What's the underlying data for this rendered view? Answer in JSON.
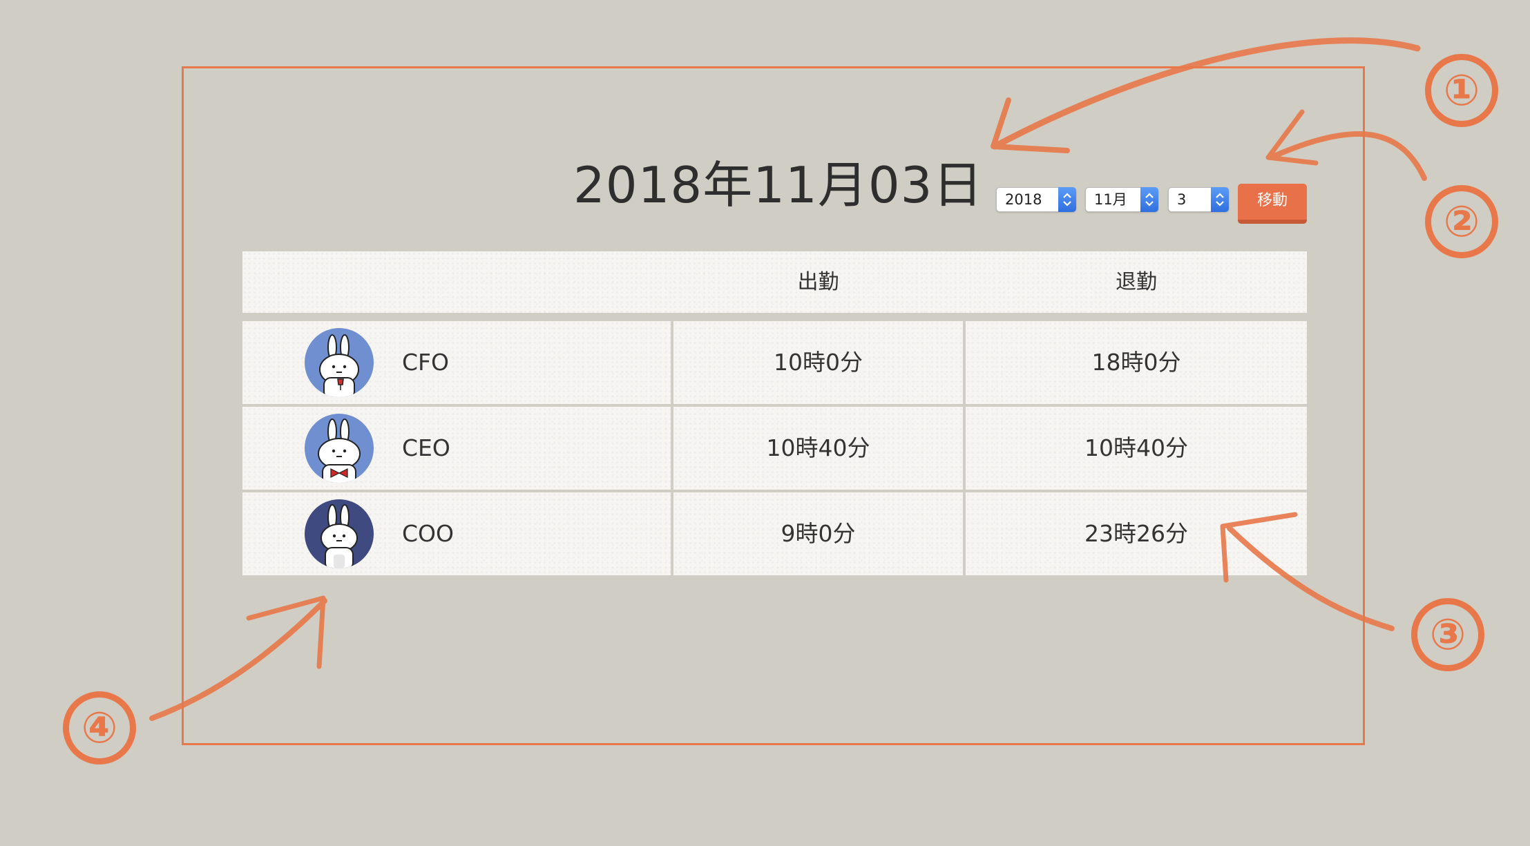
{
  "header": {
    "date_title": "2018年11月03日",
    "year_select": "2018",
    "month_select": "11月",
    "day_select": "3",
    "go_button": "移動"
  },
  "table": {
    "columns": [
      "",
      "出勤",
      "退勤"
    ],
    "rows": [
      {
        "role": "CFO",
        "clock_in": "10時0分",
        "clock_out": "18時0分",
        "avatar": "rabbit-with-wine-icon"
      },
      {
        "role": "CEO",
        "clock_in": "10時40分",
        "clock_out": "10時40分",
        "avatar": "rabbit-with-bowtie-icon"
      },
      {
        "role": "COO",
        "clock_in": "9時0分",
        "clock_out": "23時26分",
        "avatar": "rabbit-dark-icon"
      }
    ]
  },
  "annotations": {
    "labels": [
      "①",
      "②",
      "③",
      "④"
    ],
    "color": "#e8784a"
  },
  "colors": {
    "background": "#d0cdc4",
    "accent": "#e8714a",
    "select_stepper": "#3b7be8",
    "avatar_light": "#6f8fd0",
    "avatar_dark": "#3e4a80"
  }
}
